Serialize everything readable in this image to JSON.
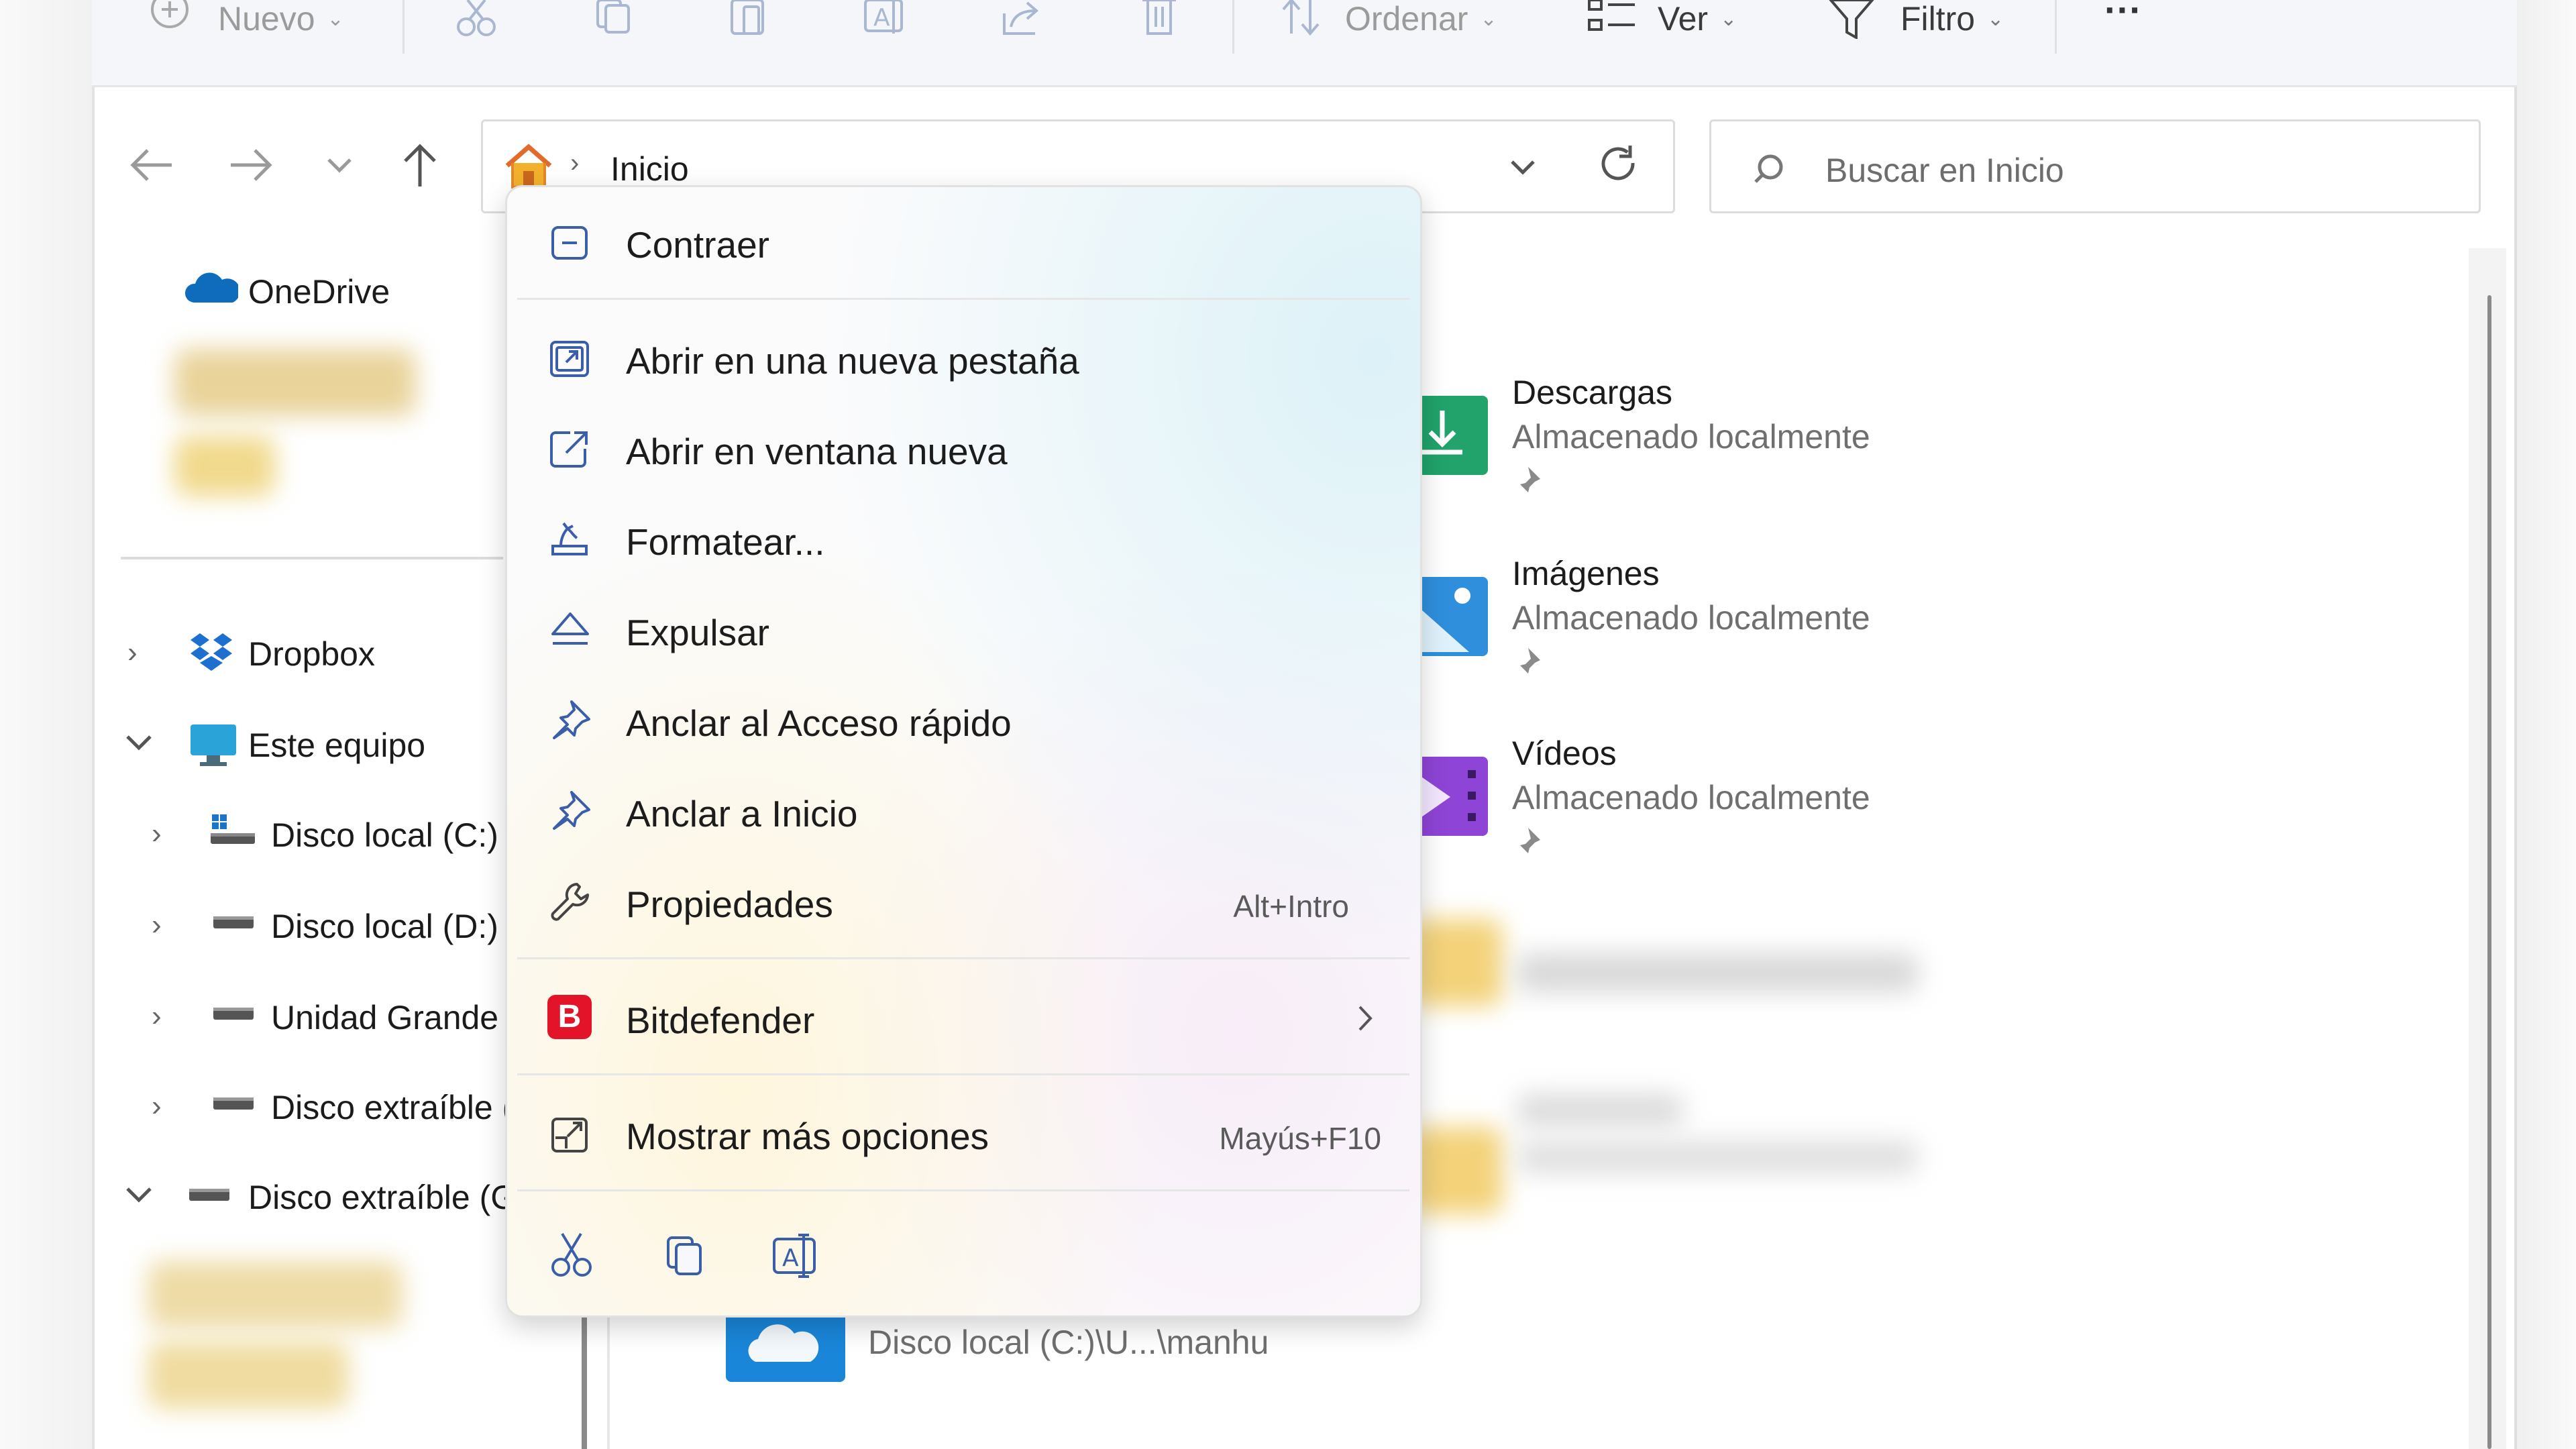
{
  "toolbar": {
    "new_label": "Nuevo",
    "sort_label": "Ordenar",
    "view_label": "Ver",
    "filter_label": "Filtro",
    "more_label": "···"
  },
  "address_bar": {
    "location": "Inicio",
    "search_placeholder": "Buscar en Inicio"
  },
  "nav_pane": {
    "onedrive": "OneDrive",
    "dropbox": "Dropbox",
    "this_pc": "Este equipo",
    "drives": [
      "Disco local (C:)",
      "Disco local (D:)",
      "Unidad Grande",
      "Disco extraíble ("
    ],
    "removable_g": "Disco extraíble (G"
  },
  "content": {
    "items": [
      {
        "name": "Descargas",
        "status": "Almacenado localmente"
      },
      {
        "name": "Imágenes",
        "status": "Almacenado localmente"
      },
      {
        "name": "Vídeos",
        "status": "Almacenado localmente"
      }
    ],
    "bottom_path": "Disco local (C:)\\U...\\manhu"
  },
  "context_menu": {
    "items": [
      {
        "label": "Contraer",
        "icon": "collapse-icon"
      },
      {
        "label": "Abrir en una nueva pestaña",
        "icon": "new-tab-icon"
      },
      {
        "label": "Abrir en ventana nueva",
        "icon": "new-window-icon"
      },
      {
        "label": "Formatear...",
        "icon": "format-icon"
      },
      {
        "label": "Expulsar",
        "icon": "eject-icon"
      },
      {
        "label": "Anclar al Acceso rápido",
        "icon": "pin-icon"
      },
      {
        "label": "Anclar a Inicio",
        "icon": "pin-icon"
      },
      {
        "label": "Propiedades",
        "icon": "wrench-icon",
        "shortcut": "Alt+Intro"
      },
      {
        "label": "Bitdefender",
        "icon": "bitdefender-icon"
      },
      {
        "label": "Mostrar más opciones",
        "icon": "more-options-icon",
        "shortcut": "Mayús+F10"
      }
    ],
    "bitdefender_letter": "B"
  },
  "colors": {
    "accent": "#2b78c5",
    "bitdefender": "#e3142a",
    "onedrive": "#0f6cbd",
    "download_green": "#21a36b",
    "video_purple": "#8e44d6"
  }
}
